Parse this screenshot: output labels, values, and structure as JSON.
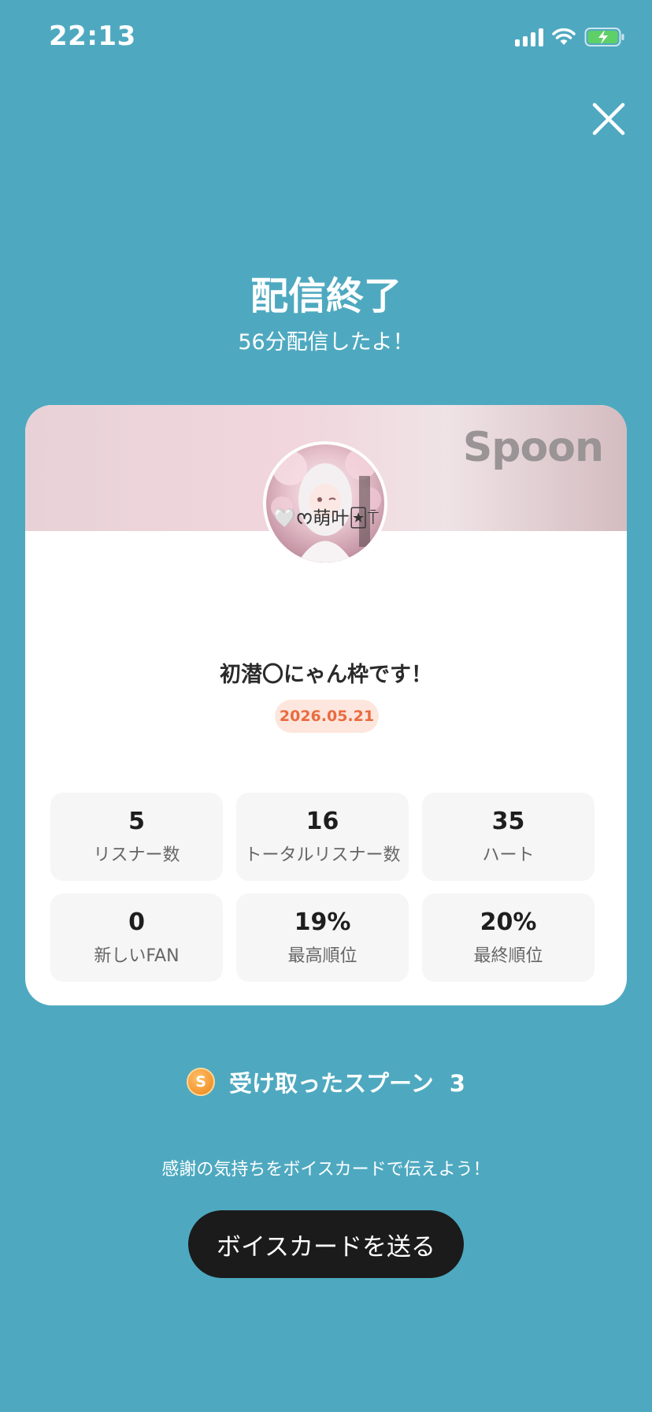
{
  "status_bar": {
    "time": "22:13",
    "icons": [
      "signal-icon",
      "wifi-icon",
      "battery-charging-icon"
    ]
  },
  "header": {
    "title": "配信終了",
    "subtitle": "56分配信したよ！",
    "close_icon": "close-icon"
  },
  "card": {
    "brand": "Spoon",
    "username": "🤍ᰔ萌叶🃏⍑",
    "stream_title": "初潜〇にゃん枠です！",
    "date": "2026.05.21",
    "stats": [
      {
        "value": "5",
        "label": "リスナー数"
      },
      {
        "value": "16",
        "label": "トータルリスナー数"
      },
      {
        "value": "35",
        "label": "ハート"
      },
      {
        "value": "0",
        "label": "新しいFAN"
      },
      {
        "value": "19%",
        "label": "最高順位"
      },
      {
        "value": "20%",
        "label": "最終順位"
      }
    ]
  },
  "spoons": {
    "coin_symbol": "S",
    "label": "受け取ったスプーン  3"
  },
  "voice_card": {
    "hint": "感謝の気持ちをボイスカードで伝えよう！",
    "button_label": "ボイスカードを送る"
  },
  "colors": {
    "background": "#4ea9c0",
    "date_badge_bg": "#fde6dd",
    "date_badge_text": "#ea6b3f",
    "button_bg": "#1b1b1b"
  }
}
